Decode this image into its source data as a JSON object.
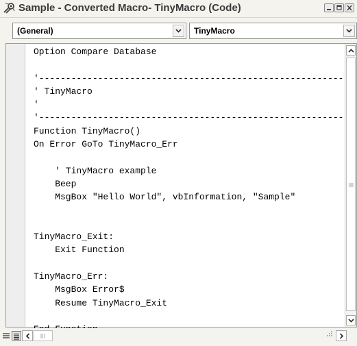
{
  "window": {
    "title": "Sample - Converted Macro- TinyMacro (Code)"
  },
  "combos": {
    "object": "(General)",
    "procedure": "TinyMacro"
  },
  "code_lines": [
    "Option Compare Database",
    "",
    "'------------------------------------------------------------",
    "' TinyMacro",
    "'",
    "'------------------------------------------------------------",
    "Function TinyMacro()",
    "On Error GoTo TinyMacro_Err",
    "",
    "    ' TinyMacro example",
    "    Beep",
    "    MsgBox \"Hello World\", vbInformation, \"Sample\"",
    "",
    "",
    "TinyMacro_Exit:",
    "    Exit Function",
    "",
    "TinyMacro_Err:",
    "    MsgBox Error$",
    "    Resume TinyMacro_Exit",
    "",
    "End Function"
  ],
  "icons": {
    "app": "macro-app-icon",
    "minimize": "minimize-icon",
    "restore": "restore-icon",
    "close": "close-icon",
    "procedure_view": "procedure-view-icon",
    "module_view": "full-module-view-icon"
  },
  "colors": {
    "chrome": "#f4f3ee",
    "code_background": "#ffffff",
    "code_text": "#000000"
  }
}
